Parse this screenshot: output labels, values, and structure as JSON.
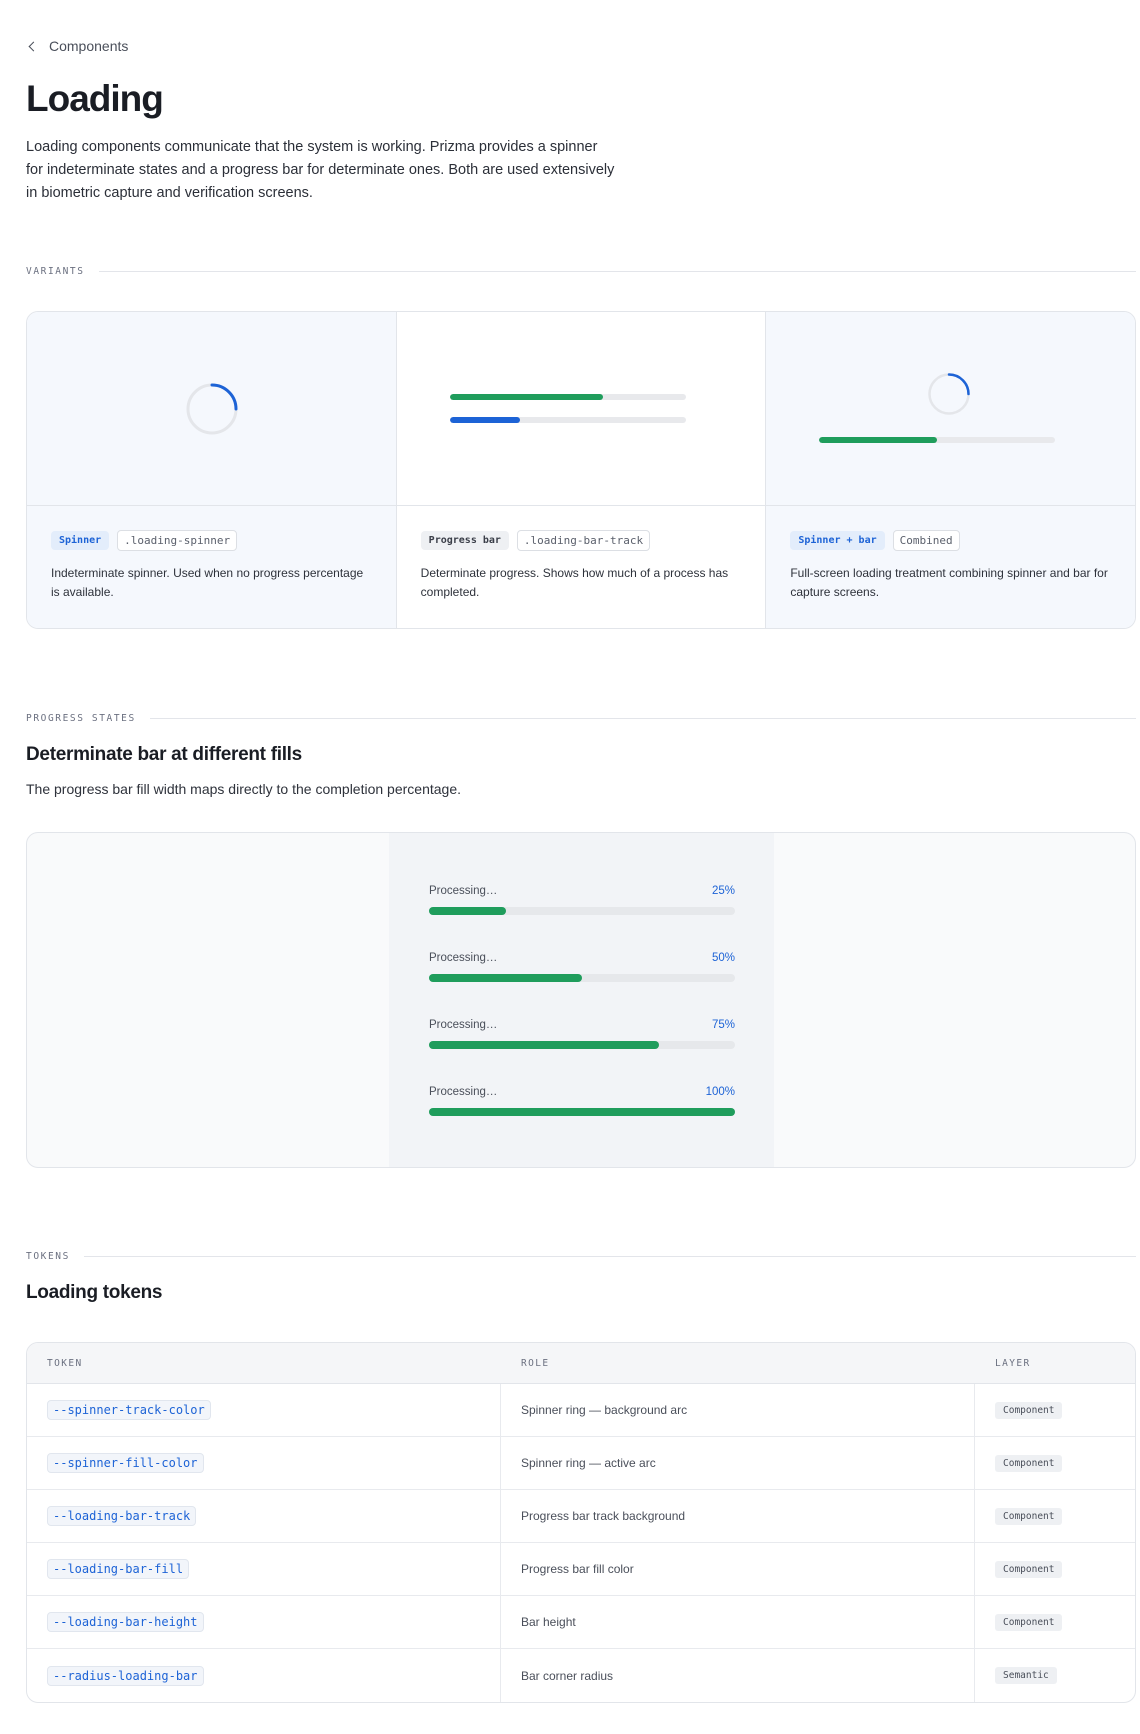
{
  "nav": {
    "back_label": "Components"
  },
  "page": {
    "title": "Loading",
    "lead": "Loading components communicate that the system is working. Prizma provides a spinner for indeterminate states and a progress bar for determinate ones. Both are used extensively in biometric capture and verification screens."
  },
  "colors": {
    "accent_blue": "#1d63d6",
    "progress_green": "#1f9d5c",
    "track_gray": "#e6e8eb"
  },
  "variants": {
    "label": "VARIANTS",
    "items": [
      {
        "tag": "Spinner",
        "class_tag": ".loading-spinner",
        "description": "Indeterminate spinner. Used when no progress percentage is available.",
        "preview": "spinner"
      },
      {
        "tag": "Progress bar",
        "class_tag": ".loading-bar-track",
        "description": "Determinate progress. Shows how much of a process has completed.",
        "preview": "bars",
        "bar_fills": [
          0.65,
          0.3
        ]
      },
      {
        "tag": "Spinner + bar",
        "class_tag": "Combined",
        "description": "Full-screen loading treatment combining spinner and bar for capture screens.",
        "preview": "combined",
        "bar_fill": 0.5
      }
    ]
  },
  "progress_states": {
    "label": "PROGRESS STATES",
    "title": "Determinate bar at different fills",
    "subtitle": "The progress bar fill width maps directly to the completion percentage.",
    "rows": [
      {
        "label": "Processing…",
        "percent": "25%",
        "fill": 0.25
      },
      {
        "label": "Processing…",
        "percent": "50%",
        "fill": 0.5
      },
      {
        "label": "Processing…",
        "percent": "75%",
        "fill": 0.75
      },
      {
        "label": "Processing…",
        "percent": "100%",
        "fill": 1.0
      }
    ]
  },
  "tokens": {
    "label": "TOKENS",
    "title": "Loading tokens",
    "columns": [
      "TOKEN",
      "ROLE",
      "LAYER"
    ],
    "rows": [
      {
        "token": "--spinner-track-color",
        "role": "Spinner ring — background arc",
        "layer": "Component"
      },
      {
        "token": "--spinner-fill-color",
        "role": "Spinner ring — active arc",
        "layer": "Component"
      },
      {
        "token": "--loading-bar-track",
        "role": "Progress bar track background",
        "layer": "Component"
      },
      {
        "token": "--loading-bar-fill",
        "role": "Progress bar fill color",
        "layer": "Component"
      },
      {
        "token": "--loading-bar-height",
        "role": "Bar height",
        "layer": "Component"
      },
      {
        "token": "--radius-loading-bar",
        "role": "Bar corner radius",
        "layer": "Semantic"
      }
    ]
  }
}
